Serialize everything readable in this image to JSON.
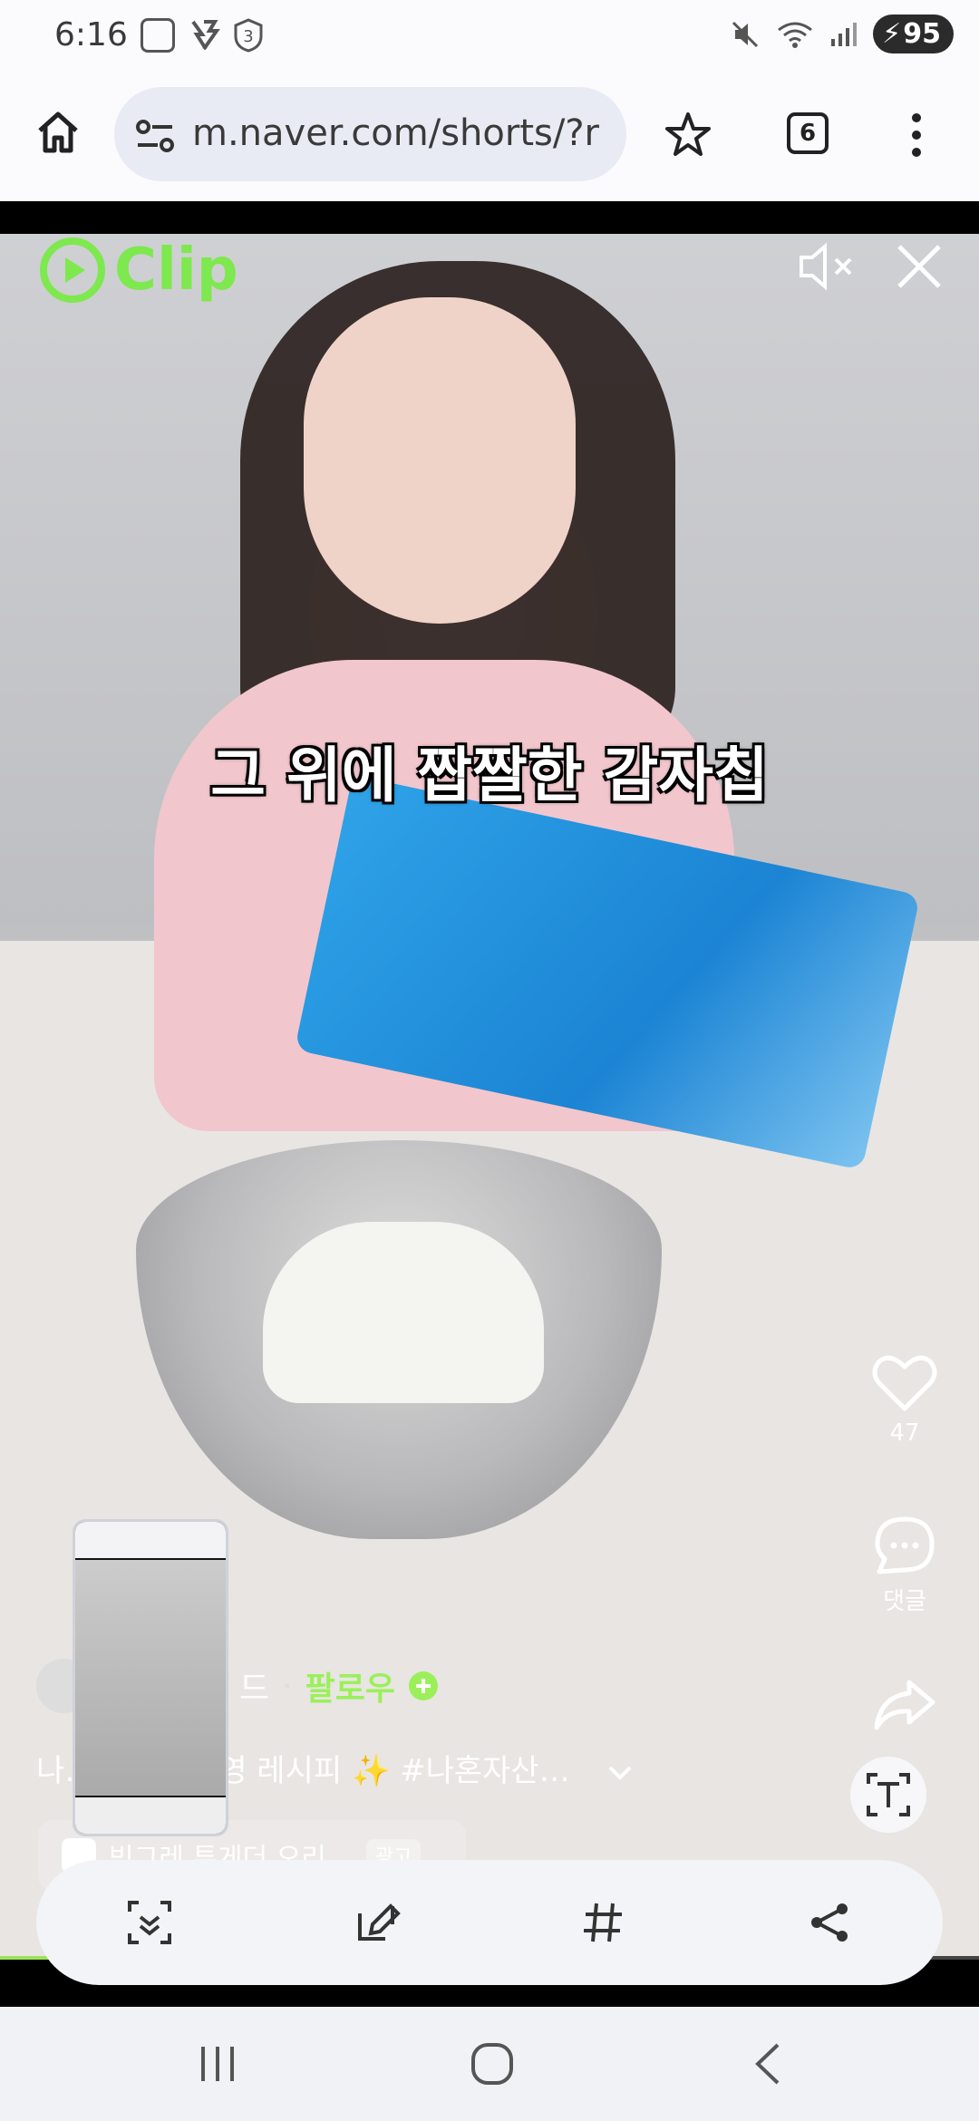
{
  "status_bar": {
    "time": "6:16",
    "badge_number": "3",
    "battery_level": "95"
  },
  "browser": {
    "url": "m.naver.com/shorts/?r",
    "tab_count": "6"
  },
  "video": {
    "logo_text": "Clip",
    "subtitle": "그 위에 짭짤한 감자칩",
    "like_count": "47",
    "comment_label": "댓글",
    "channel_name": "드",
    "follow_label": "팔로우",
    "description": "나…제의 김신영 레시피 ✨ #나혼자산…",
    "ad_title": "빙그레 투게더 오리…",
    "ad_badge": "광고",
    "progress_fraction": 0.26
  },
  "colors": {
    "accent_green": "#7ee84f",
    "follow_green": "#9bf05a"
  },
  "icons": [
    "home-icon",
    "site-settings-icon",
    "bookmark-star-icon",
    "more-vert-icon",
    "clip-logo-icon",
    "mute-icon",
    "close-icon",
    "heart-icon",
    "comment-icon",
    "share-icon",
    "text-extract-icon",
    "scan-icon",
    "edit-icon",
    "hashtag-icon",
    "share-nodes-icon",
    "recent-apps-icon",
    "home-circle-icon",
    "back-icon"
  ]
}
